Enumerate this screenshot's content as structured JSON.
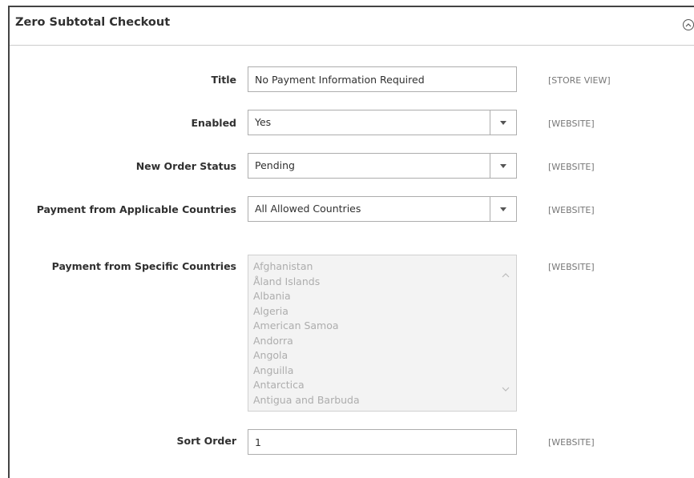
{
  "section": {
    "title": "Zero Subtotal Checkout"
  },
  "fields": {
    "title": {
      "label": "Title",
      "value": "No Payment Information Required",
      "scope": "[STORE VIEW]"
    },
    "enabled": {
      "label": "Enabled",
      "value": "Yes",
      "scope": "[WEBSITE]"
    },
    "new_order_status": {
      "label": "New Order Status",
      "value": "Pending",
      "scope": "[WEBSITE]"
    },
    "applicable_countries": {
      "label": "Payment from Applicable Countries",
      "value": "All Allowed Countries",
      "scope": "[WEBSITE]"
    },
    "specific_countries": {
      "label": "Payment from Specific Countries",
      "scope": "[WEBSITE]",
      "options": [
        "Afghanistan",
        "Åland Islands",
        "Albania",
        "Algeria",
        "American Samoa",
        "Andorra",
        "Angola",
        "Anguilla",
        "Antarctica",
        "Antigua and Barbuda"
      ]
    },
    "sort_order": {
      "label": "Sort Order",
      "value": "1",
      "scope": "[WEBSITE]"
    }
  },
  "colors": {
    "border": "#adadad",
    "disabled_bg": "#f3f3f3",
    "disabled_text": "#adadad",
    "scope_text": "#777777"
  }
}
